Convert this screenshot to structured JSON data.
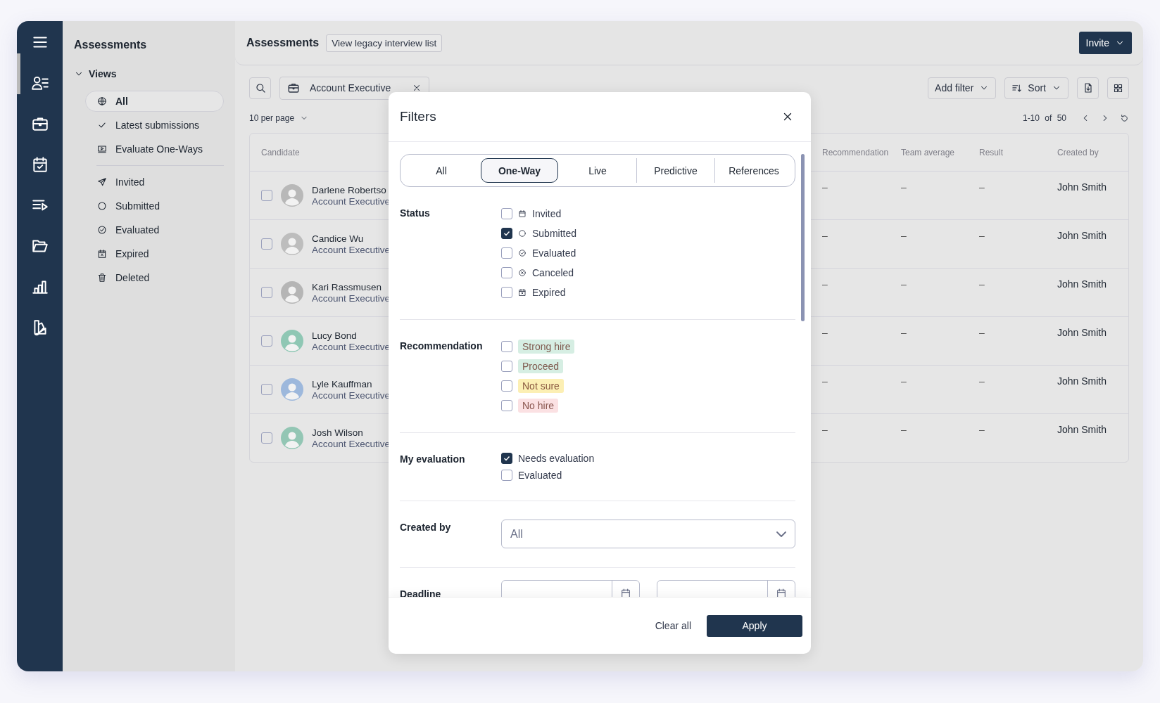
{
  "nav": {
    "items": [
      {
        "selected": true
      },
      {
        "selected": false
      },
      {
        "selected": false
      },
      {
        "selected": false
      },
      {
        "selected": false
      },
      {
        "selected": false
      },
      {
        "selected": false
      }
    ]
  },
  "sidebar": {
    "title": "Assessments",
    "views_label": "Views",
    "views_expanded": true,
    "views": [
      {
        "label": "All",
        "selected": true
      },
      {
        "label": "Latest submissions",
        "selected": false
      },
      {
        "label": "Evaluate One-Ways",
        "selected": false
      }
    ],
    "statuses": [
      {
        "label": "Invited",
        "selected": false
      },
      {
        "label": "Submitted",
        "selected": false
      },
      {
        "label": "Evaluated",
        "selected": false
      },
      {
        "label": "Expired",
        "selected": false
      },
      {
        "label": "Deleted",
        "selected": false
      }
    ]
  },
  "header": {
    "title": "Assessments",
    "legacy_link": "View legacy interview list",
    "invite": "Invite"
  },
  "toolbar": {
    "chip": "Account Executive",
    "add_filter": "Add filter",
    "sort": "Sort",
    "per_page": "10 per page",
    "range": "1-10 of 50"
  },
  "table": {
    "columns": [
      "Candidate",
      "Recommendation",
      "Team average",
      "Result",
      "Created by"
    ],
    "rows": [
      {
        "checked": false,
        "name": "Darlene Robertso",
        "role": "Account Executive",
        "recommendation": "–",
        "team_average": "–",
        "result": "–",
        "created_by": "John Smith"
      },
      {
        "checked": false,
        "name": "Candice Wu",
        "role": "Account Executive",
        "recommendation": "–",
        "team_average": "–",
        "result": "–",
        "created_by": "John Smith"
      },
      {
        "checked": false,
        "name": "Kari Rassmusen",
        "role": "Account Executive",
        "recommendation": "–",
        "team_average": "–",
        "result": "–",
        "created_by": "John Smith"
      },
      {
        "checked": false,
        "name": "Lucy Bond",
        "role": "Account Executive",
        "recommendation": "–",
        "team_average": "–",
        "result": "–",
        "created_by": "John Smith"
      },
      {
        "checked": false,
        "name": "Lyle Kauffman",
        "role": "Account Executive",
        "recommendation": "–",
        "team_average": "–",
        "result": "–",
        "created_by": "John Smith"
      },
      {
        "checked": false,
        "name": "Josh Wilson",
        "role": "Account Executive",
        "recommendation": "–",
        "team_average": "–",
        "result": "–",
        "created_by": "John Smith"
      }
    ]
  },
  "filters": {
    "title": "Filters",
    "tabs": [
      {
        "label": "All",
        "selected": false
      },
      {
        "label": "One-Way",
        "selected": true
      },
      {
        "label": "Live",
        "selected": false
      },
      {
        "label": "Predictive",
        "selected": false
      },
      {
        "label": "References",
        "selected": false
      }
    ],
    "sections": [
      {
        "kind": "icon_checklist",
        "label": "Status",
        "options": [
          {
            "label": "Invited",
            "checked": false
          },
          {
            "label": "Submitted",
            "checked": true
          },
          {
            "label": "Evaluated",
            "checked": false
          },
          {
            "label": "Canceled",
            "checked": false
          },
          {
            "label": "Expired",
            "checked": false
          }
        ]
      },
      {
        "kind": "tags",
        "label": "Recommendation",
        "options": [
          {
            "label": "Strong hire",
            "checked": false,
            "color": "#d6eee3"
          },
          {
            "label": "Proceed",
            "checked": false,
            "color": "#d6eee3"
          },
          {
            "label": "Not sure",
            "checked": false,
            "color": "#fcefb4"
          },
          {
            "label": "No hire",
            "checked": false,
            "color": "#fbe1e3"
          }
        ]
      },
      {
        "kind": "checklist",
        "label": "My evaluation",
        "options": [
          {
            "label": "Needs evaluation",
            "checked": true
          },
          {
            "label": "Evaluated",
            "checked": false
          }
        ]
      },
      {
        "kind": "select",
        "label": "Created by",
        "value": "All"
      },
      {
        "kind": "daterange",
        "label": "Deadline"
      }
    ],
    "clear": "Clear all",
    "apply": "Apply"
  }
}
